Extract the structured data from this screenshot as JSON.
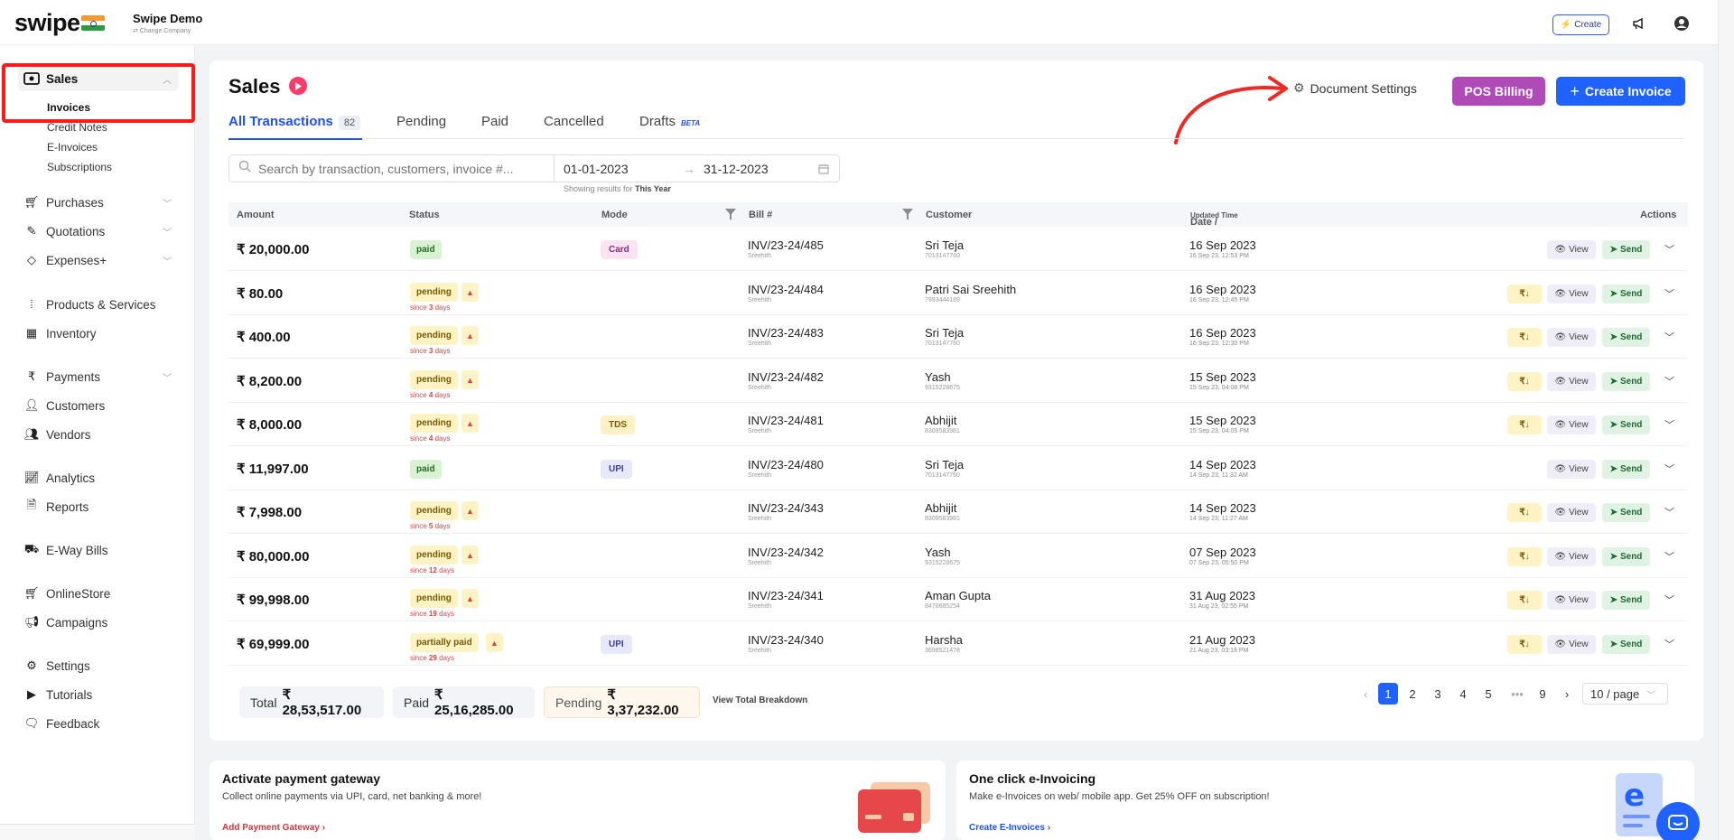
{
  "app": {
    "logo": "swipe",
    "company_name": "Swipe Demo",
    "company_sub": "⇄ Change Company",
    "create_label": "Create"
  },
  "sidebar": {
    "sales": "Sales",
    "sub_items": [
      "Invoices",
      "Credit Notes",
      "E-Invoices",
      "Subscriptions"
    ],
    "items": [
      {
        "label": "Purchases",
        "icon": "cart-icon"
      },
      {
        "label": "Quotations",
        "icon": "pen-icon"
      },
      {
        "label": "Expenses+",
        "icon": "tag-icon"
      },
      {
        "label": "Products & Services",
        "icon": "barcode-icon"
      },
      {
        "label": "Inventory",
        "icon": "inventory-icon"
      },
      {
        "label": "Payments",
        "icon": "rupee-icon"
      },
      {
        "label": "Customers",
        "icon": "user-icon"
      },
      {
        "label": "Vendors",
        "icon": "users-icon"
      },
      {
        "label": "Analytics",
        "icon": "chart-icon"
      },
      {
        "label": "Reports",
        "icon": "report-icon"
      },
      {
        "label": "E-Way Bills",
        "icon": "truck-icon"
      },
      {
        "label": "OnlineStore",
        "icon": "store-icon"
      },
      {
        "label": "Campaigns",
        "icon": "megaphone-icon"
      },
      {
        "label": "Settings",
        "icon": "gear-icon"
      },
      {
        "label": "Tutorials",
        "icon": "youtube-icon"
      },
      {
        "label": "Feedback",
        "icon": "feedback-icon"
      }
    ]
  },
  "header": {
    "title": "Sales",
    "doc_settings": "Document Settings",
    "pos_billing": "POS Billing",
    "create_invoice": "Create Invoice"
  },
  "tabs": {
    "all": "All Transactions",
    "all_count": "82",
    "pending": "Pending",
    "paid": "Paid",
    "cancelled": "Cancelled",
    "drafts": "Drafts",
    "beta": "BETA"
  },
  "search": {
    "placeholder": "Search by transaction, customers, invoice #...",
    "date_from": "01-01-2023",
    "date_to": "31-12-2023",
    "showing_prefix": "Showing results for",
    "showing_period": "This Year"
  },
  "table": {
    "headers": {
      "amount": "Amount",
      "status": "Status",
      "mode": "Mode",
      "bill": "Bill #",
      "customer": "Customer",
      "date": "Date /",
      "date_sub": "Updated Time",
      "actions": "Actions"
    },
    "labels": {
      "view": "View",
      "send": "Send",
      "since": "since",
      "days": "days"
    },
    "rows": [
      {
        "amount": "₹ 20,000.00",
        "status": "paid",
        "since": "",
        "mode": "Card",
        "bill": "INV/23-24/485",
        "bill_sub": "Sreehith",
        "customer": "Sri Teja",
        "phone": "7013147760",
        "date": "16 Sep 2023",
        "time": "16 Sep 23, 12:53 PM",
        "rupee": false
      },
      {
        "amount": "₹ 80.00",
        "status": "pending",
        "since": "3",
        "mode": "",
        "bill": "INV/23-24/484",
        "bill_sub": "Sreehith",
        "customer": "Patri Sai Sreehith",
        "phone": "7993444189",
        "date": "16 Sep 2023",
        "time": "16 Sep 23, 12:45 PM",
        "rupee": true
      },
      {
        "amount": "₹ 400.00",
        "status": "pending",
        "since": "3",
        "mode": "",
        "bill": "INV/23-24/483",
        "bill_sub": "Sreehith",
        "customer": "Sri Teja",
        "phone": "7013147760",
        "date": "16 Sep 2023",
        "time": "16 Sep 23, 12:30 PM",
        "rupee": true
      },
      {
        "amount": "₹ 8,200.00",
        "status": "pending",
        "since": "4",
        "mode": "",
        "bill": "INV/23-24/482",
        "bill_sub": "Sreehith",
        "customer": "Yash",
        "phone": "9315228675",
        "date": "15 Sep 2023",
        "time": "15 Sep 23, 04:08 PM",
        "rupee": true
      },
      {
        "amount": "₹ 8,000.00",
        "status": "pending",
        "since": "4",
        "mode": "TDS",
        "bill": "INV/23-24/481",
        "bill_sub": "Sreehith",
        "customer": "Abhijit",
        "phone": "8309583981",
        "date": "15 Sep 2023",
        "time": "15 Sep 23, 04:05 PM",
        "rupee": true
      },
      {
        "amount": "₹ 11,997.00",
        "status": "paid",
        "since": "",
        "mode": "UPI",
        "bill": "INV/23-24/480",
        "bill_sub": "Sreehith",
        "customer": "Sri Teja",
        "phone": "7013147760",
        "date": "14 Sep 2023",
        "time": "14 Sep 23, 11:32 AM",
        "rupee": false
      },
      {
        "amount": "₹ 7,998.00",
        "status": "pending",
        "since": "5",
        "mode": "",
        "bill": "INV/23-24/343",
        "bill_sub": "Sreehith",
        "customer": "Abhijit",
        "phone": "8309583981",
        "date": "14 Sep 2023",
        "time": "14 Sep 23, 11:27 AM",
        "rupee": true
      },
      {
        "amount": "₹ 80,000.00",
        "status": "pending",
        "since": "12",
        "mode": "",
        "bill": "INV/23-24/342",
        "bill_sub": "Sreehith",
        "customer": "Yash",
        "phone": "9315228675",
        "date": "07 Sep 2023",
        "time": "07 Sep 23, 05:50 PM",
        "rupee": true
      },
      {
        "amount": "₹ 99,998.00",
        "status": "pending",
        "since": "19",
        "mode": "",
        "bill": "INV/23-24/341",
        "bill_sub": "Sreehith",
        "customer": "Aman Gupta",
        "phone": "8470685254",
        "date": "31 Aug 2023",
        "time": "31 Aug 23, 02:55 PM",
        "rupee": true
      },
      {
        "amount": "₹ 69,999.00",
        "status": "partially paid",
        "since": "29",
        "mode": "UPI",
        "bill": "INV/23-24/340",
        "bill_sub": "Sreehith",
        "customer": "Harsha",
        "phone": "3698521478",
        "date": "21 Aug 2023",
        "time": "21 Aug 23, 03:18 PM",
        "rupee": true
      }
    ]
  },
  "totals": {
    "total_label": "Total",
    "total_value": "₹ 28,53,517.00",
    "paid_label": "Paid",
    "paid_value": "₹ 25,16,285.00",
    "pending_label": "Pending",
    "pending_value": "₹ 3,37,232.00",
    "breakdown": "View Total Breakdown"
  },
  "pagination": {
    "pages": [
      "1",
      "2",
      "3",
      "4",
      "5",
      "•••",
      "9"
    ],
    "current": "1",
    "per_page": "10 / page"
  },
  "promos": [
    {
      "title": "Activate payment gateway",
      "desc": "Collect online payments via UPI, card, net banking & more!",
      "link": "Add Payment Gateway ›"
    },
    {
      "title": "One click e-Invoicing",
      "desc": "Make e-Invoices on web/ mobile app. Get 25% OFF on subscription!",
      "link": "Create E-Invoices ›"
    }
  ],
  "colors": {
    "accent": "#1f62ff",
    "pos": "#b04ab8",
    "annotation": "#ff1a1a"
  }
}
